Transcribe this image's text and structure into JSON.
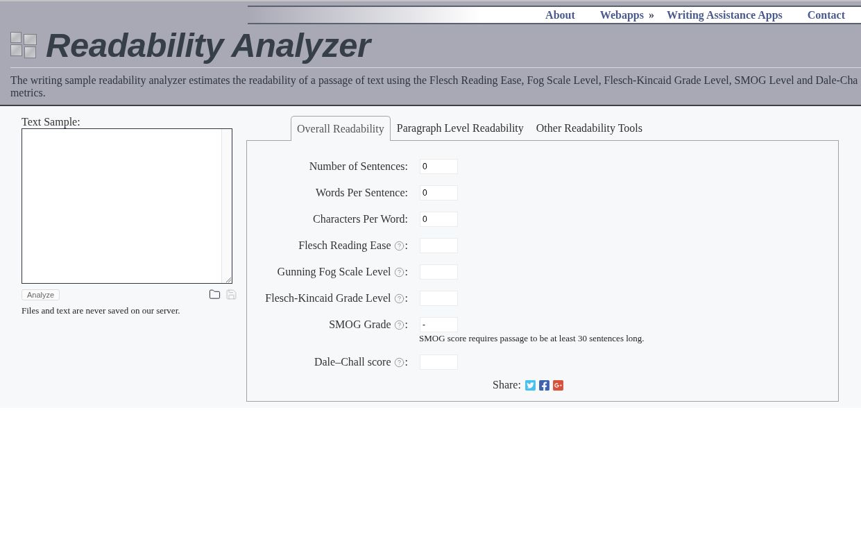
{
  "header": {
    "nav": [
      {
        "label": "About"
      },
      {
        "label": "Webapps",
        "marker": "»"
      },
      {
        "label": "Writing Assistance Apps"
      },
      {
        "label": "Contact"
      }
    ],
    "title": "Readability Analyzer",
    "description_lines": [
      "The writing sample readability analyzer estimates the readability of a passage of text using the Flesch Reading Ease, Fog Scale Level, Flesch-Kincaid Grade Level, SMOG Level and Dale-Cha",
      "metrics."
    ]
  },
  "text_sample": {
    "label": "Text Sample:",
    "analyze_button": "Analyze",
    "note": "Files and text are never saved on our server."
  },
  "tabs": [
    {
      "label": "Overall Readability",
      "selected": true
    },
    {
      "label": "Paragraph Level Readability",
      "selected": false
    },
    {
      "label": "Other Readability Tools",
      "selected": false
    }
  ],
  "metrics": [
    {
      "label": "Number of Sentences:",
      "help_icon": false,
      "value": "0"
    },
    {
      "label": "Words Per Sentence:",
      "help_icon": false,
      "value": "0"
    },
    {
      "label": "Characters Per Word:",
      "help_icon": false,
      "value": "0"
    },
    {
      "label": "Flesch Reading Ease",
      "help_icon": true,
      "after_icon": ":"
    },
    {
      "label": "Gunning Fog Scale Level",
      "help_icon": true,
      "after_icon": ":"
    },
    {
      "label": "Flesch-Kincaid Grade Level",
      "help_icon": true,
      "after_icon": ":"
    },
    {
      "label": "SMOG Grade",
      "help_icon": true,
      "after_icon": ":",
      "value": "-",
      "note": "SMOG score requires passage to be at least 30 sentences long."
    },
    {
      "label": "Dale–Chall score",
      "help_icon": true,
      "after_icon": ":"
    }
  ],
  "share": {
    "label": "Share:"
  }
}
